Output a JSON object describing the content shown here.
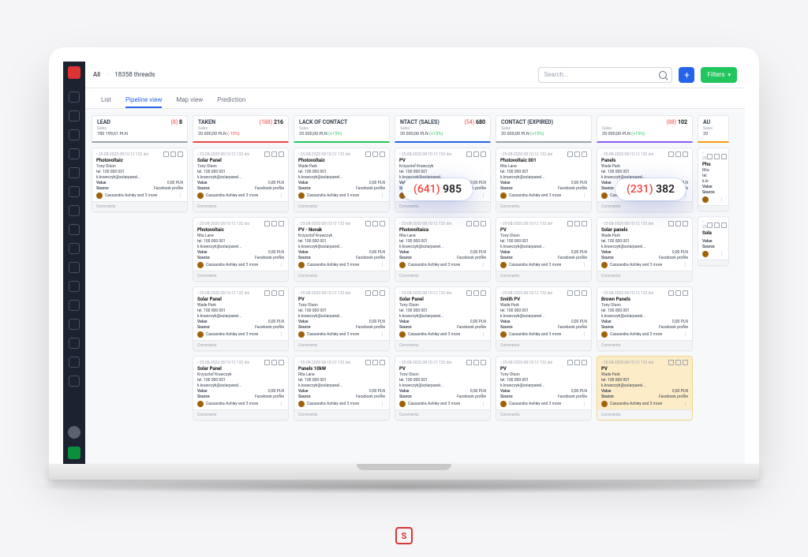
{
  "breadcrumb": {
    "root": "All",
    "threads_label": "18358 threads"
  },
  "search": {
    "placeholder": "Search..."
  },
  "buttons": {
    "filters": "Filters"
  },
  "tabs": {
    "list": "List",
    "pipeline": "Pipeline view",
    "map": "Map view",
    "prediction": "Prediction"
  },
  "bubbles": [
    {
      "red": "(641)",
      "main": "985"
    },
    {
      "red": "(231)",
      "main": "382"
    }
  ],
  "columns": [
    {
      "title": "LEAD",
      "count_pre": "(8)",
      "count": "8",
      "sub": "Sales",
      "amount": "780 199,61 PLN",
      "accent": "#9ca3af",
      "cards": [
        {
          "date": "25-08-2020 08:10:12 132 dni",
          "name": "Photovoltaic",
          "person": "Tony Olson",
          "phone": "tel. 100 000 001",
          "email": "k.krawczyk@solarpanel...",
          "value": "0,00 PLN",
          "source": "Facebook profile",
          "assignees": "Cassandra Ashley and 3 more",
          "comments": "Comments"
        }
      ]
    },
    {
      "title": "TAKEN",
      "count_pre": "(188)",
      "count": "216",
      "sub": "Sales",
      "amount": "20 000,00 PLN",
      "pct": "(-15%)",
      "pct_pos": false,
      "accent": "#ef4444",
      "cards": [
        {
          "date": "25-08-2020 08:10:12 132 dni",
          "name": "Solar Panel",
          "person": "Tony Olson",
          "phone": "tel. 100 000 001",
          "email": "k.krawczyk@solarpanel...",
          "value": "0,00 PLN",
          "source": "Facebook profile",
          "assignees": "Cassandra Ashley and 3 more",
          "comments": "Comments"
        },
        {
          "date": "25-08-2020 08:10:12 132 dni",
          "name": "Photovoltaic",
          "person": "Rita Lane",
          "phone": "tel. 100 000 001",
          "email": "k.krawczyk@solarpanel...",
          "value": "0,00 PLN",
          "source": "Facebook profile",
          "assignees": "Cassandra Ashley and 3 more",
          "comments": "Comments"
        },
        {
          "date": "25-08-2020 08:10:12 132 dni",
          "name": "Solar Panel",
          "person": "Wade Park",
          "phone": "tel. 100 000 001",
          "email": "k.krawczyk@solarpanel...",
          "value": "0,00 PLN",
          "source": "Facebook profile",
          "assignees": "Cassandra Ashley and 3 more",
          "comments": "Comments"
        },
        {
          "date": "25-08-2020 08:10:12 132 dni",
          "name": "Solar Panel",
          "person": "Krzysztof Krawczyk",
          "phone": "tel. 100 000 001",
          "email": "k.krawczyk@solarpanel...",
          "value": "0,00 PLN",
          "source": "Facebook profile",
          "assignees": "Cassandra Ashley and 3 more",
          "comments": "Comments"
        }
      ]
    },
    {
      "title": "LACK OF CONTACT",
      "count_pre": "",
      "count": "",
      "sub": "Sales",
      "amount": "20 000,00 PLN",
      "pct": "(+15%)",
      "pct_pos": true,
      "accent": "#22c55e",
      "cards": [
        {
          "date": "25-08-2020 08:10:12 132 dni",
          "name": "Photovoltaic",
          "person": "Wade Park",
          "phone": "tel. 100 000 001",
          "email": "k.krawczyk@solarpanel...",
          "value": "0,00 PLN",
          "source": "Facebook profile",
          "assignees": "Cassandra Ashley and 3 more",
          "comments": "Comments"
        },
        {
          "date": "25-08-2020 08:10:12 132 dni",
          "name": "PV - Novak",
          "person": "Krzysztof Krawczyk",
          "phone": "tel. 100 000 001",
          "email": "k.krawczyk@solarpanel...",
          "value": "0,00 PLN",
          "source": "Facebook profile",
          "assignees": "Cassandra Ashley and 3 more",
          "comments": "Comments"
        },
        {
          "date": "25-08-2020 08:10:12 132 dni",
          "name": "PV",
          "person": "Tony Olson",
          "phone": "tel. 100 000 001",
          "email": "k.krawczyk@solarpanel...",
          "value": "0,00 PLN",
          "source": "Facebook profile",
          "assignees": "Cassandra Ashley and 3 more",
          "comments": "Comments"
        },
        {
          "date": "25-08-2020 08:10:12 132 dni",
          "name": "Panels 10kW",
          "person": "Rita Lane",
          "phone": "tel. 100 000 001",
          "email": "k.krawczyk@solarpanel...",
          "value": "0,00 PLN",
          "source": "Facebook profile",
          "assignees": "Cassandra Ashley and 3 more",
          "comments": "Comments"
        }
      ]
    },
    {
      "title": "NTACT (SALES)",
      "count_pre": "(54)",
      "count": "680",
      "sub": "Sales",
      "amount": "20 000,00 PLN",
      "pct": "(+15%)",
      "pct_pos": true,
      "accent": "#2563eb",
      "cards": [
        {
          "date": "25-08-2020 08:10:12 132 dni",
          "name": "PV",
          "person": "Krzysztof Krawczyk",
          "phone": "tel. 100 000 001",
          "email": "k.krawczyk@solarpanel...",
          "value": "0,00 PLN",
          "source": "Facebook profile",
          "assignees": "Cassandra Ashley and 3 more",
          "comments": "Comments"
        },
        {
          "date": "25-08-2020 08:10:12 132 dni",
          "name": "Photovoltaica",
          "person": "Rita Lane",
          "phone": "tel. 100 000 001",
          "email": "k.krawczyk@solarpanel...",
          "value": "0,00 PLN",
          "source": "Facebook profile",
          "assignees": "Cassandra Ashley and 3 more",
          "comments": "Comments"
        },
        {
          "date": "25-08-2020 08:10:12 132 dni",
          "name": "Solar Panel",
          "person": "Tony Olson",
          "phone": "tel. 100 000 001",
          "email": "k.krawczyk@solarpanel...",
          "value": "0,00 PLN",
          "source": "Facebook profile",
          "assignees": "Cassandra Ashley and 3 more",
          "comments": "Comments"
        },
        {
          "date": "25-08-2020 08:10:12 132 dni",
          "name": "PV",
          "person": "Tony Olson",
          "phone": "tel. 100 000 001",
          "email": "k.krawczyk@solarpanel...",
          "value": "0,00 PLN",
          "source": "Facebook profile",
          "assignees": "Cassandra Ashley and 3 more",
          "comments": "Comments"
        }
      ]
    },
    {
      "title": "CONTACT (EXPIRED)",
      "count_pre": "",
      "count": "",
      "sub": "Sales",
      "amount": "20 000,00 PLN",
      "pct": "(+15%)",
      "pct_pos": true,
      "accent": "#9ca3af",
      "cards": [
        {
          "date": "25-08-2020 08:10:12 132 dni",
          "name": "Photovoltaic 001",
          "person": "Rita Lane",
          "phone": "tel. 100 000 001",
          "email": "k.krawczyk@solarpanel...",
          "value": "0,00 PLN",
          "source": "Facebook profile",
          "assignees": "Cassandra Ashley and 3 more",
          "comments": "Comments"
        },
        {
          "date": "25-08-2020 08:10:12 132 dni",
          "name": "PV",
          "person": "Tony Olson",
          "phone": "tel. 100 000 001",
          "email": "k.krawczyk@solarpanel...",
          "value": "0,00 PLN",
          "source": "Facebook profile",
          "assignees": "Cassandra Ashley and 3 more",
          "comments": "Comments"
        },
        {
          "date": "25-08-2020 08:10:12 132 dni",
          "name": "Smith PV",
          "person": "Wade Park",
          "phone": "tel. 100 000 001",
          "email": "k.krawczyk@solarpanel...",
          "value": "0,00 PLN",
          "source": "Facebook profile",
          "assignees": "Cassandra Ashley and 3 more",
          "comments": "Comments"
        },
        {
          "date": "25-08-2020 08:10:12 132 dni",
          "name": "PV",
          "person": "Tony Olson",
          "phone": "tel. 100 000 001",
          "email": "k.krawczyk@solarpanel...",
          "value": "0,00 PLN",
          "source": "Facebook profile",
          "assignees": "Cassandra Ashley and 3 more",
          "comments": "Comments"
        }
      ]
    },
    {
      "title": "",
      "count_pre": "(88)",
      "count": "102",
      "sub": "Sales",
      "amount": "20 000,00 PLN",
      "pct": "(+15%)",
      "pct_pos": true,
      "accent": "#8b5cf6",
      "cards": [
        {
          "date": "25-08-2020 08:10:12 132 dni",
          "name": "Panels",
          "person": "Wade Park",
          "phone": "tel. 100 000 001",
          "email": "k.krawczyk@solarpanel...",
          "value": "0,00 PLN",
          "source": "Facebook profile",
          "assignees": "Cassandra Ashley and 3 more",
          "comments": "Comments"
        },
        {
          "date": "25-08-2020 08:10:12 132 dni",
          "name": "Solar panels",
          "person": "Wade Park",
          "phone": "tel. 100 000 001",
          "email": "k.krawczyk@solarpanel...",
          "value": "0,00 PLN",
          "source": "Facebook profile",
          "assignees": "Cassandra Ashley and 3 more",
          "comments": "Comments"
        },
        {
          "date": "25-08-2020 08:10:12 132 dni",
          "name": "Brown Panels",
          "person": "Tony Olson",
          "phone": "tel. 100 000 001",
          "email": "k.krawczyk@solarpanel...",
          "value": "0,00 PLN",
          "source": "Facebook profile",
          "assignees": "Cassandra Ashley and 3 more",
          "comments": "Comments"
        },
        {
          "date": "25-08-2020 08:10:12 132 dni",
          "name": "PV",
          "person": "Wade Park",
          "phone": "tel. 100 000 001",
          "email": "k.krawczyk@solarpanel...",
          "value": "0,00 PLN",
          "source": "Facebook profile",
          "assignees": "Cassandra Ashley and 3 more",
          "comments": "Comments",
          "highlight": true
        }
      ]
    },
    {
      "title": "AU",
      "count_pre": "",
      "count": "",
      "sub": "Sales",
      "amount": "20",
      "accent": "#f59e0b",
      "cards": [
        {
          "date": "25",
          "name": "Pho",
          "person": "Rita",
          "phone": "tel.",
          "email": "k.kr",
          "value": "",
          "source": "",
          "assignees": "",
          "comments": ""
        },
        {
          "date": "25",
          "name": "Sola",
          "person": "",
          "phone": "",
          "email": "",
          "value": "",
          "source": "",
          "assignees": "",
          "comments": ""
        }
      ],
      "cut": true
    }
  ],
  "labels": {
    "value": "Value",
    "source": "Source"
  }
}
